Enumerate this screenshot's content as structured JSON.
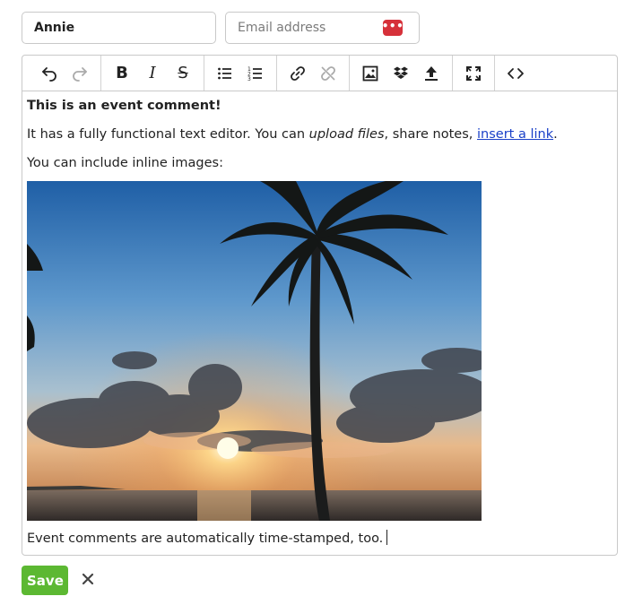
{
  "form": {
    "name_value": "Annie",
    "email_placeholder": "Email address",
    "email_icon": "password-manager-icon"
  },
  "toolbar": {
    "groups": [
      [
        "undo-icon",
        "redo-icon"
      ],
      [
        "bold-icon",
        "italic-icon",
        "strikethrough-icon"
      ],
      [
        "bulleted-list-icon",
        "numbered-list-icon"
      ],
      [
        "link-icon",
        "unlink-icon"
      ],
      [
        "image-icon",
        "dropbox-icon",
        "upload-icon"
      ],
      [
        "fullscreen-icon"
      ],
      [
        "code-view-icon"
      ]
    ],
    "bold_label": "B",
    "italic_label": "I",
    "strike_label": "S"
  },
  "content": {
    "heading": "This is an event comment!",
    "para1_before": "It has a fully functional text editor. You can ",
    "para1_italic": "upload files",
    "para1_middle": ", share notes, ",
    "para1_link": "insert a link",
    "para1_after": ".",
    "para2": "You can include inline images:",
    "image": "palm tree and sunset over the ocean",
    "footer": "Event comments are automatically time-stamped, too."
  },
  "actions": {
    "save_label": "Save",
    "close_icon": "close-icon"
  },
  "colors": {
    "save_bg": "#5cb832",
    "link": "#1a40c8",
    "icon_badge": "#d6313a"
  }
}
